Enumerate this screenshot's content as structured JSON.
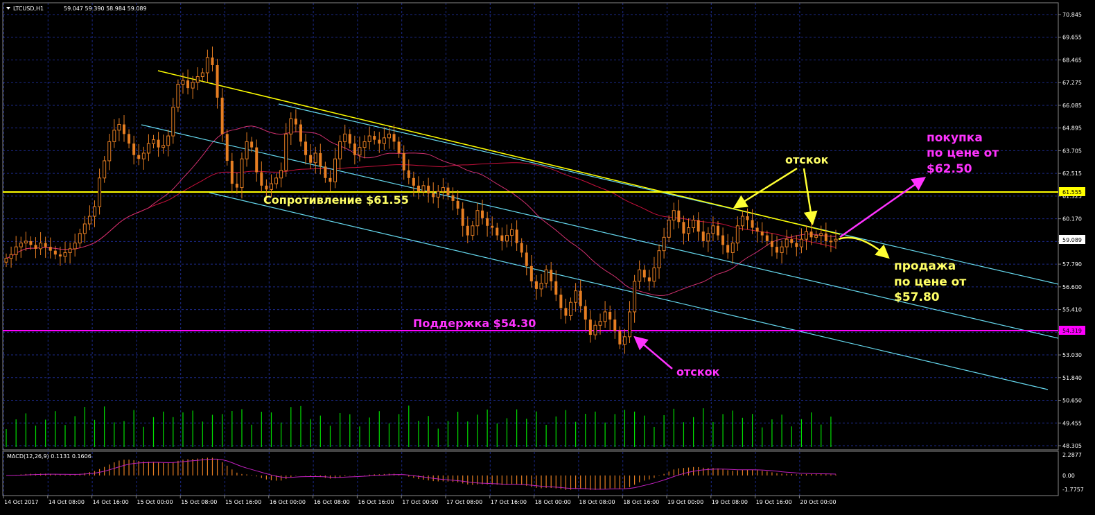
{
  "header": {
    "symbol": "LTCUSD,H1",
    "ohlc": "59.047 59.390 58.984 59.089"
  },
  "macd_header": "MACD(12,26,9) 0.1131 0.1606",
  "colors": {
    "background": "#000000",
    "grid": "#1a237e",
    "candle_up": "#e67e22",
    "candle_down": "#e67e22",
    "volume": "#00e000",
    "resistance": "#ffff00",
    "support": "#ff00ff",
    "channel": "#66d9ef",
    "ma_slow": "#cc2244",
    "ma_fast": "#cc2266"
  },
  "price_axis": {
    "ticks": [
      "70.845",
      "69.655",
      "68.465",
      "67.275",
      "66.085",
      "64.895",
      "63.705",
      "62.515",
      "61.325",
      "60.170",
      "58.980",
      "57.790",
      "56.600",
      "55.410",
      "54.220",
      "53.030",
      "51.840",
      "50.650",
      "49.455",
      "48.305"
    ],
    "current": "59.089",
    "resistance_tag": "61.555",
    "support_tag": "54.319"
  },
  "macd_axis": {
    "ticks": [
      "2.2877",
      "0.00",
      "-1.7757"
    ]
  },
  "time_axis": {
    "labels": [
      "14 Oct 2017",
      "14 Oct 08:00",
      "14 Oct 16:00",
      "15 Oct 00:00",
      "15 Oct 08:00",
      "15 Oct 16:00",
      "16 Oct 00:00",
      "16 Oct 08:00",
      "16 Oct 16:00",
      "17 Oct 00:00",
      "17 Oct 08:00",
      "17 Oct 16:00",
      "18 Oct 00:00",
      "18 Oct 08:00",
      "18 Oct 16:00",
      "19 Oct 00:00",
      "19 Oct 08:00",
      "19 Oct 16:00",
      "20 Oct 00:00"
    ]
  },
  "annotations": {
    "resistance_label": "Сопротивление $61.55",
    "support_label": "Поддержка $54.30",
    "bounce_top": "отскок",
    "bounce_bottom": "отскок",
    "buy_line1": "покупка",
    "buy_line2": "по цене от",
    "buy_line3": "$62.50",
    "sell_line1": "продажа",
    "sell_line2": "по цене от",
    "sell_line3": "$57.80"
  },
  "chart_data": {
    "type": "candlestick",
    "symbol": "LTCUSD",
    "timeframe": "H1",
    "ylim": [
      48.0,
      71.5
    ],
    "resistance_level": 61.555,
    "support_level": 54.319,
    "closes": [
      58.1,
      58.3,
      58.7,
      58.9,
      59.0,
      58.8,
      58.6,
      58.9,
      58.7,
      58.5,
      58.3,
      58.2,
      58.4,
      58.6,
      58.9,
      59.4,
      59.9,
      60.3,
      60.8,
      62.3,
      63.2,
      64.2,
      64.8,
      65.1,
      64.6,
      64.1,
      63.5,
      63.3,
      63.6,
      64.1,
      64.3,
      63.9,
      64.0,
      64.5,
      66.0,
      67.2,
      67.4,
      67.0,
      67.3,
      67.6,
      67.8,
      68.6,
      68.2,
      66.5,
      64.6,
      63.2,
      62.0,
      61.8,
      63.3,
      64.2,
      63.9,
      62.6,
      61.9,
      61.7,
      62.0,
      62.3,
      62.7,
      64.6,
      65.4,
      65.1,
      64.2,
      63.5,
      63.1,
      63.6,
      62.9,
      62.3,
      62.1,
      63.3,
      64.2,
      64.6,
      64.1,
      63.5,
      63.9,
      64.2,
      64.5,
      64.3,
      64.1,
      64.4,
      64.6,
      64.2,
      63.6,
      62.7,
      62.3,
      61.9,
      61.6,
      61.9,
      61.5,
      61.3,
      61.6,
      61.8,
      61.4,
      61.1,
      60.7,
      59.8,
      59.3,
      59.8,
      60.6,
      60.2,
      59.8,
      59.7,
      59.3,
      59.0,
      59.3,
      59.6,
      58.9,
      58.4,
      57.7,
      56.9,
      56.5,
      56.8,
      57.5,
      56.9,
      56.2,
      55.5,
      55.1,
      55.8,
      56.4,
      55.6,
      54.9,
      54.1,
      54.6,
      54.8,
      55.3,
      54.9,
      54.3,
      53.6,
      54.0,
      55.3,
      56.9,
      57.5,
      57.1,
      56.9,
      57.6,
      58.5,
      59.2,
      60.1,
      60.6,
      60.0,
      59.4,
      59.7,
      60.1,
      59.5,
      59.0,
      59.4,
      59.8,
      59.3,
      58.8,
      58.4,
      58.9,
      59.8,
      60.3,
      60.1,
      59.7,
      59.5,
      59.3,
      59.0,
      58.7,
      58.4,
      58.7,
      59.1,
      58.9,
      58.7,
      59.1,
      59.5,
      59.2,
      59.3,
      59.4,
      59.0,
      59.0,
      59.1
    ]
  }
}
